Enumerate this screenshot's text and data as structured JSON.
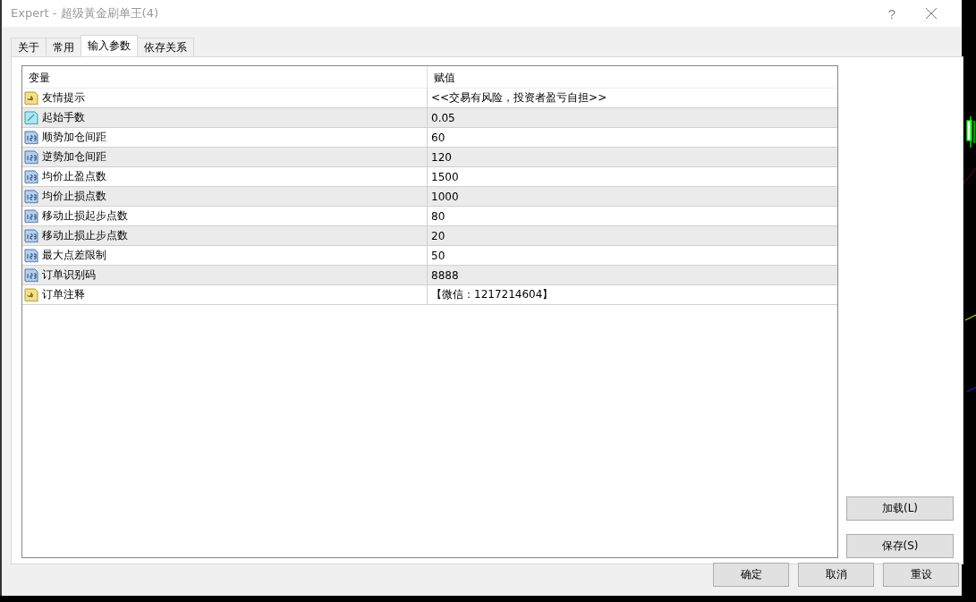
{
  "window": {
    "title": "Expert - 超级黃金刷单王(4)",
    "help": "?"
  },
  "tabs": [
    {
      "label": "关于",
      "selected": false
    },
    {
      "label": "常用",
      "selected": false
    },
    {
      "label": "输入参数",
      "selected": true
    },
    {
      "label": "依存关系",
      "selected": false
    }
  ],
  "table": {
    "columns": [
      "变量",
      "赋值"
    ],
    "rows": [
      {
        "kind": "string",
        "name": "友情提示",
        "value": "<<交易有风险，投资者盈亏自担>>"
      },
      {
        "kind": "double",
        "name": "起始手数",
        "value": "0.05"
      },
      {
        "kind": "int",
        "name": "顺势加仓间距",
        "value": "60"
      },
      {
        "kind": "int",
        "name": "逆势加仓间距",
        "value": "120"
      },
      {
        "kind": "int",
        "name": "均价止盈点数",
        "value": "1500"
      },
      {
        "kind": "int",
        "name": "均价止损点数",
        "value": "1000"
      },
      {
        "kind": "int",
        "name": "移动止损起步点数",
        "value": "80"
      },
      {
        "kind": "int",
        "name": "移动止损止步点数",
        "value": "20"
      },
      {
        "kind": "int",
        "name": "最大点差限制",
        "value": "50"
      },
      {
        "kind": "int",
        "name": "订单识别码",
        "value": "8888"
      },
      {
        "kind": "string",
        "name": "订单注释",
        "value": "【微信：1217214604】"
      }
    ]
  },
  "side_buttons": [
    "加载(L)",
    "保存(S)"
  ],
  "buttons": [
    "确定",
    "取消",
    "重设"
  ]
}
